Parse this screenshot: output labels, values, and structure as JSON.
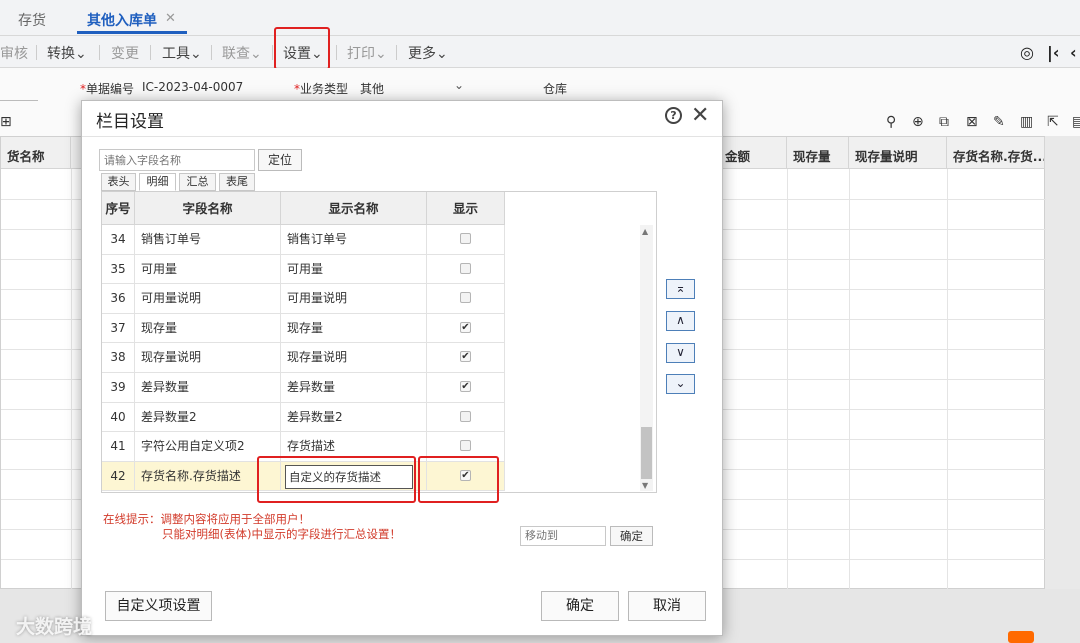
{
  "tabs": [
    "存货",
    "其他入库单"
  ],
  "tab_close": "✕",
  "toolbar": {
    "items": [
      "审核",
      "转换",
      "变更",
      "工具",
      "联查",
      "设置",
      "打印",
      "更多"
    ]
  },
  "form": {
    "doc_no_label": "单据编号",
    "doc_no_value": "IC-2023-04-0007",
    "biz_type_label": "业务类型",
    "biz_type_value": "其他",
    "warehouse_label": "仓库"
  },
  "grid": {
    "headers": [
      "货名称",
      "金额",
      "现存量",
      "现存量说明",
      "存货名称.存货..."
    ]
  },
  "dialog": {
    "title": "栏目设置",
    "search_placeholder": "请输入字段名称",
    "locate_label": "定位",
    "subtabs": [
      "表头",
      "明细",
      "汇总",
      "表尾"
    ],
    "columns": [
      "序号",
      "字段名称",
      "显示名称",
      "显示"
    ],
    "rows": [
      {
        "no": "34",
        "field": "销售订单号",
        "display": "销售订单号",
        "show": false
      },
      {
        "no": "35",
        "field": "可用量",
        "display": "可用量",
        "show": false
      },
      {
        "no": "36",
        "field": "可用量说明",
        "display": "可用量说明",
        "show": false
      },
      {
        "no": "37",
        "field": "现存量",
        "display": "现存量",
        "show": true
      },
      {
        "no": "38",
        "field": "现存量说明",
        "display": "现存量说明",
        "show": true
      },
      {
        "no": "39",
        "field": "差异数量",
        "display": "差异数量",
        "show": true
      },
      {
        "no": "40",
        "field": "差异数量2",
        "display": "差异数量2",
        "show": false
      },
      {
        "no": "41",
        "field": "字符公用自定义项2",
        "display": "存货描述",
        "show": false
      },
      {
        "no": "42",
        "field": "存货名称.存货描述",
        "display": "自定义的存货描述",
        "show": true
      }
    ],
    "hint_prefix": "在线提示：调整内容将应用于全部用户！",
    "hint_line2": "只能对明细(表体)中显示的字段进行汇总设置！",
    "moveto_placeholder": "移动到",
    "moveto_ok": "确定",
    "custom_btn": "自定义项设置",
    "ok_btn": "确定",
    "cancel_btn": "取消",
    "checkmark": "✔"
  },
  "watermark": "大数跨境",
  "colors": {
    "accent": "#1f5fbf",
    "highlight": "#e02020",
    "selected_row": "#fdf6d3",
    "hint": "#d23b2b"
  }
}
